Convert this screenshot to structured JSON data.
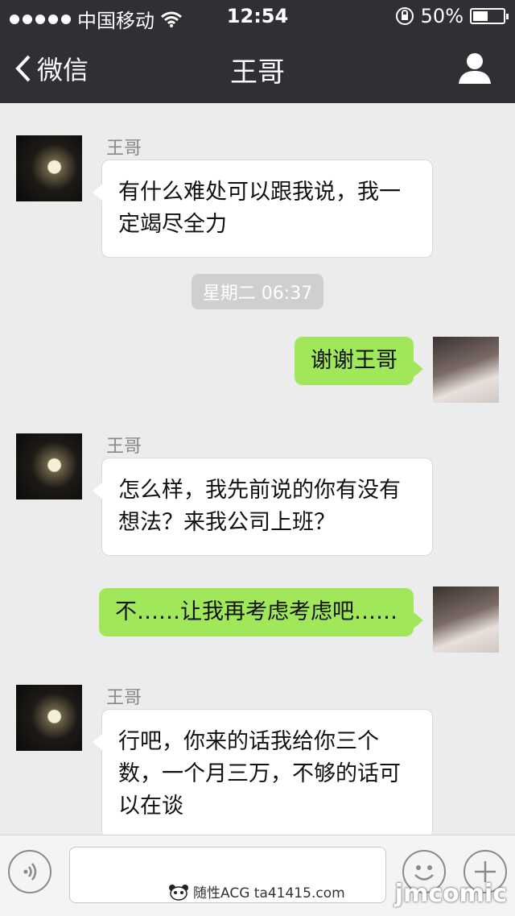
{
  "status_bar": {
    "carrier": "中国移动",
    "time": "12:54",
    "battery_percent": "50%",
    "battery_level": 0.5
  },
  "nav": {
    "back_label": "微信",
    "title": "王哥"
  },
  "messages": [
    {
      "sender": "王哥",
      "direction": "in",
      "text": "有什么难处可以跟我说，我一定竭尽全力"
    },
    {
      "direction": "out",
      "text": "谢谢王哥"
    },
    {
      "sender": "王哥",
      "direction": "in",
      "text": "怎么样，我先前说的你有没有想法？来我公司上班？"
    },
    {
      "direction": "out",
      "text": "不……让我再考虑考虑吧……"
    },
    {
      "sender": "王哥",
      "direction": "in",
      "text": "行吧，你来的话我给你三个数，一个月三万，不够的话可以在谈"
    }
  ],
  "timestamp": "星期二 06:37",
  "watermark": "随性ACG ta41415.com",
  "brand_watermark": "jmcomic",
  "colors": {
    "header_bg": "#2f3033",
    "chat_bg": "#ececec",
    "outgoing_bubble": "#a0e75a",
    "incoming_bubble": "#ffffff"
  },
  "icons": [
    "signal-dots-icon",
    "wifi-icon",
    "rotation-lock-icon",
    "battery-icon",
    "back-chevron-icon",
    "profile-icon",
    "voice-icon",
    "emoji-icon",
    "plus-icon",
    "panda-icon"
  ]
}
